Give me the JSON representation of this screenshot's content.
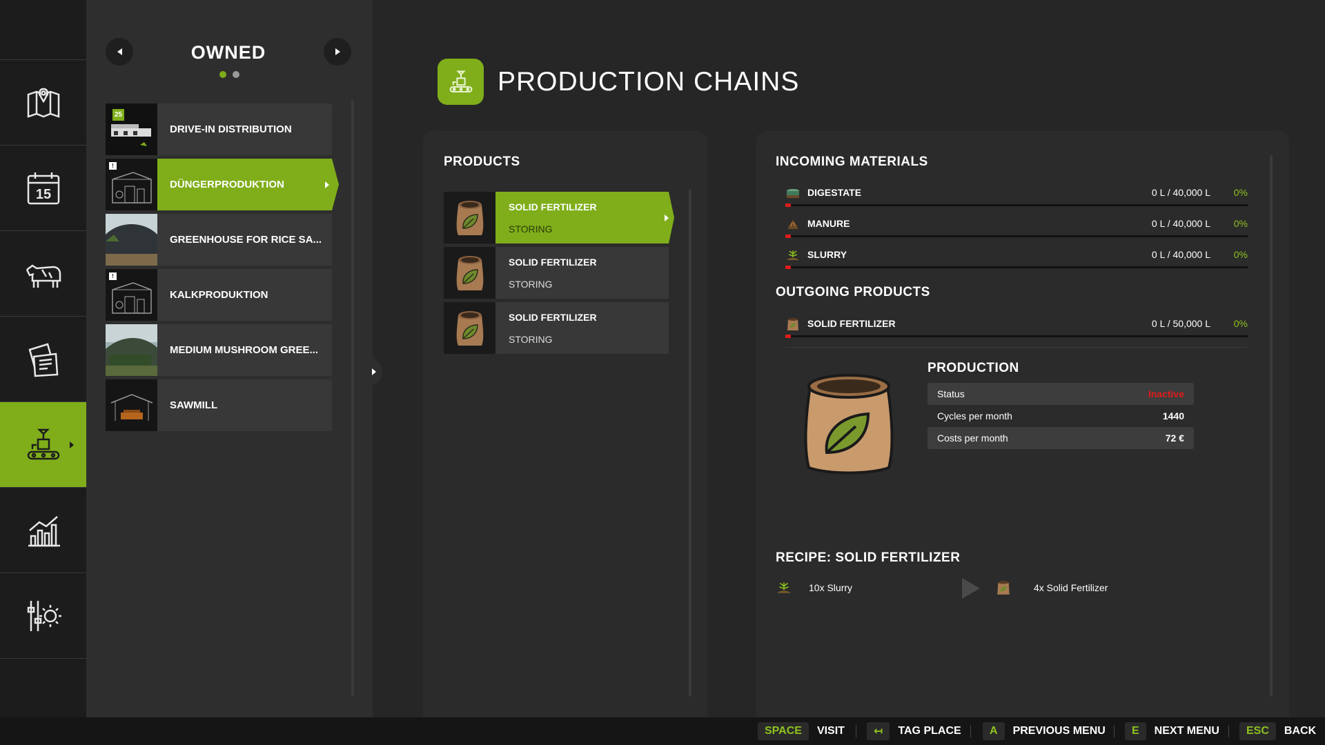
{
  "sidebar": {
    "items": [
      {
        "name": "map-icon"
      },
      {
        "name": "calendar-icon",
        "label": "15"
      },
      {
        "name": "animals-icon"
      },
      {
        "name": "contracts-icon"
      },
      {
        "name": "production-icon",
        "active": true
      },
      {
        "name": "statistics-icon"
      },
      {
        "name": "settings-icon"
      }
    ]
  },
  "owned": {
    "title": "OWNED",
    "page_dots": 2,
    "active_dot": 0,
    "places": [
      {
        "name": "DRIVE-IN DISTRIBUTION",
        "badge": "25"
      },
      {
        "name": "DÜNGERPRODUKTION",
        "badge": "!",
        "active": true
      },
      {
        "name": "GREENHOUSE FOR RICE SA..."
      },
      {
        "name": "KALKPRODUKTION",
        "badge": "!"
      },
      {
        "name": "MEDIUM MUSHROOM GREE..."
      },
      {
        "name": "SAWMILL"
      }
    ]
  },
  "header": {
    "title": "PRODUCTION CHAINS"
  },
  "products": {
    "title": "PRODUCTS",
    "items": [
      {
        "name": "SOLID FERTILIZER",
        "status": "STORING",
        "active": true
      },
      {
        "name": "SOLID FERTILIZER",
        "status": "STORING"
      },
      {
        "name": "SOLID FERTILIZER",
        "status": "STORING"
      }
    ]
  },
  "incoming": {
    "title": "INCOMING MATERIALS",
    "items": [
      {
        "name": "DIGESTATE",
        "amount": "0 L / 40,000 L",
        "percent": "0%",
        "fill": 0
      },
      {
        "name": "MANURE",
        "amount": "0 L / 40,000 L",
        "percent": "0%",
        "fill": 0
      },
      {
        "name": "SLURRY",
        "amount": "0 L / 40,000 L",
        "percent": "0%",
        "fill": 0
      }
    ]
  },
  "outgoing": {
    "title": "OUTGOING PRODUCTS",
    "items": [
      {
        "name": "SOLID FERTILIZER",
        "amount": "0 L / 50,000 L",
        "percent": "0%",
        "fill": 0
      }
    ]
  },
  "production": {
    "title": "PRODUCTION",
    "rows": [
      {
        "label": "Status",
        "value": "Inactive",
        "status_color": "#e01b1b"
      },
      {
        "label": "Cycles per month",
        "value": "1440"
      },
      {
        "label": "Costs per month",
        "value": "72 €"
      }
    ]
  },
  "recipe": {
    "title": "RECIPE: SOLID FERTILIZER",
    "input": "10x Slurry",
    "output": "4x Solid Fertilizer"
  },
  "footer": {
    "hints": [
      {
        "key": "SPACE",
        "label": "VISIT"
      },
      {
        "key": "↤",
        "label": "TAG PLACE"
      },
      {
        "key": "A",
        "label": "PREVIOUS MENU"
      },
      {
        "key": "E",
        "label": "NEXT MENU"
      },
      {
        "key": "ESC",
        "label": "BACK"
      }
    ]
  },
  "colors": {
    "accent": "#7fae1a",
    "warning": "#e01b1b",
    "percent": "#8ec21f"
  }
}
